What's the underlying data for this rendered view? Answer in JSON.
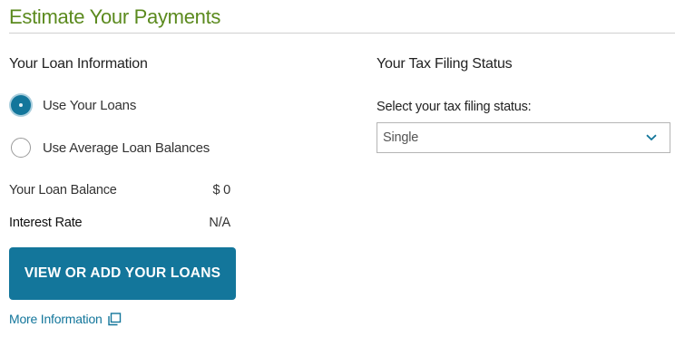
{
  "page": {
    "title": "Estimate Your Payments"
  },
  "loan_info": {
    "heading": "Your Loan Information",
    "options": [
      {
        "label": "Use Your Loans",
        "selected": true
      },
      {
        "label": "Use Average Loan Balances",
        "selected": false
      }
    ],
    "balance_label": "Your Loan Balance",
    "balance_value": "$ 0",
    "rate_label": "Interest Rate",
    "rate_value": "N/A",
    "button_label": "VIEW OR ADD YOUR LOANS",
    "more_info_label": "More Information",
    "more_info_icon": "external-window-icon"
  },
  "tax_status": {
    "heading": "Your Tax Filing Status",
    "field_label": "Select your tax filing status:",
    "selected_value": "Single",
    "dropdown_icon": "chevron-down-icon"
  },
  "colors": {
    "title_green": "#5b8a1e",
    "accent_blue": "#13769b",
    "rule_gray": "#cfcfcf"
  }
}
